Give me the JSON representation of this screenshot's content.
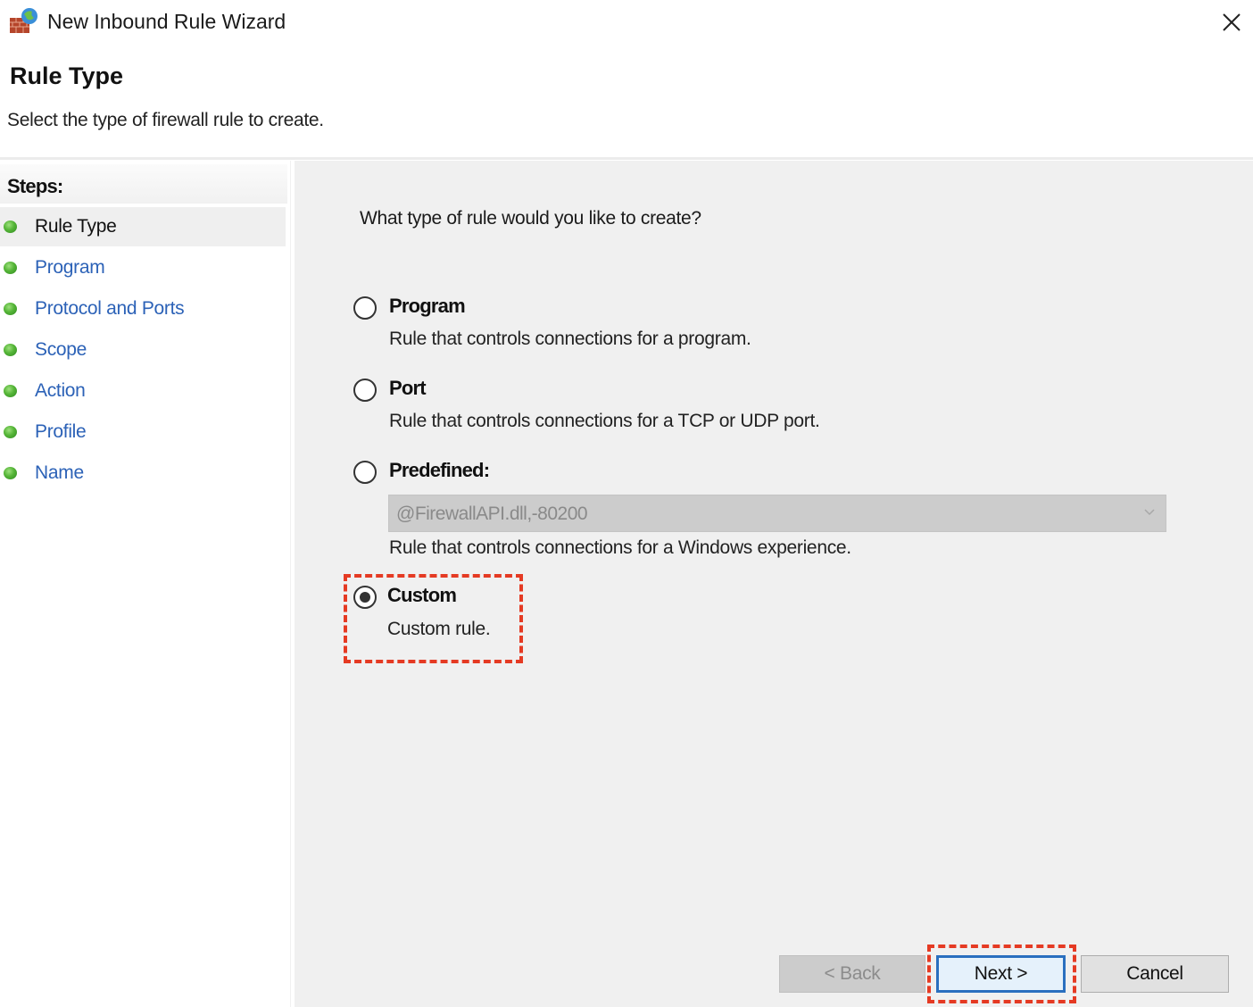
{
  "window": {
    "title": "New Inbound Rule Wizard",
    "app_icon": "firewall-icon",
    "close_icon": "close-icon"
  },
  "header": {
    "title": "Rule Type",
    "subtitle": "Select the type of firewall rule to create."
  },
  "sidebar": {
    "steps_title": "Steps:",
    "items": [
      {
        "label": "Rule Type",
        "active": true
      },
      {
        "label": "Program",
        "active": false
      },
      {
        "label": "Protocol and Ports",
        "active": false
      },
      {
        "label": "Scope",
        "active": false
      },
      {
        "label": "Action",
        "active": false
      },
      {
        "label": "Profile",
        "active": false
      },
      {
        "label": "Name",
        "active": false
      }
    ]
  },
  "main": {
    "question": "What type of rule would you like to create?",
    "options": [
      {
        "label": "Program",
        "description": "Rule that controls connections for a program.",
        "selected": false
      },
      {
        "label": "Port",
        "description": "Rule that controls connections for a TCP or UDP port.",
        "selected": false
      },
      {
        "label": "Predefined:",
        "description": "Rule that controls connections for a Windows experience.",
        "selected": false
      },
      {
        "label": "Custom",
        "description": "Custom rule.",
        "selected": true
      }
    ],
    "predefined_dropdown": {
      "value": "@FirewallAPI.dll,-80200",
      "enabled": false
    }
  },
  "footer": {
    "back_label": "< Back",
    "next_label": "Next >",
    "cancel_label": "Cancel"
  },
  "annotations": {
    "highlight_color": "#e53a23"
  }
}
